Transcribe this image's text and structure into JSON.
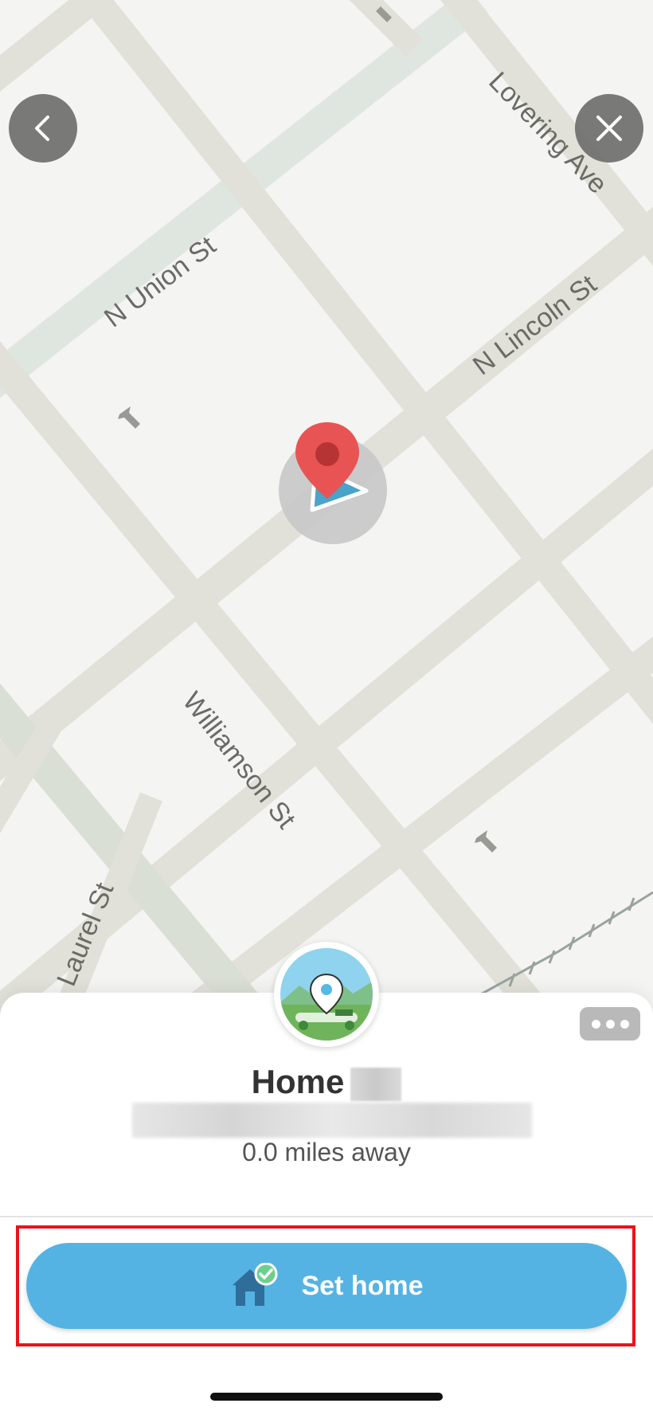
{
  "map": {
    "streets": [
      "N Union St",
      "Lovering Ave",
      "N Lincoln St",
      "Williamson St",
      "Laurel St"
    ]
  },
  "nav": {
    "back_icon": "chevron-left-icon",
    "close_icon": "close-icon"
  },
  "place": {
    "title": "Home",
    "distance": "0.0 miles away"
  },
  "actions": {
    "more_icon": "more-icon",
    "set_home_label": "Set home",
    "set_home_icon": "home-check-icon"
  },
  "colors": {
    "primary_button": "#55b3e3",
    "highlight": "#e8141b",
    "pin": "#e85454"
  }
}
